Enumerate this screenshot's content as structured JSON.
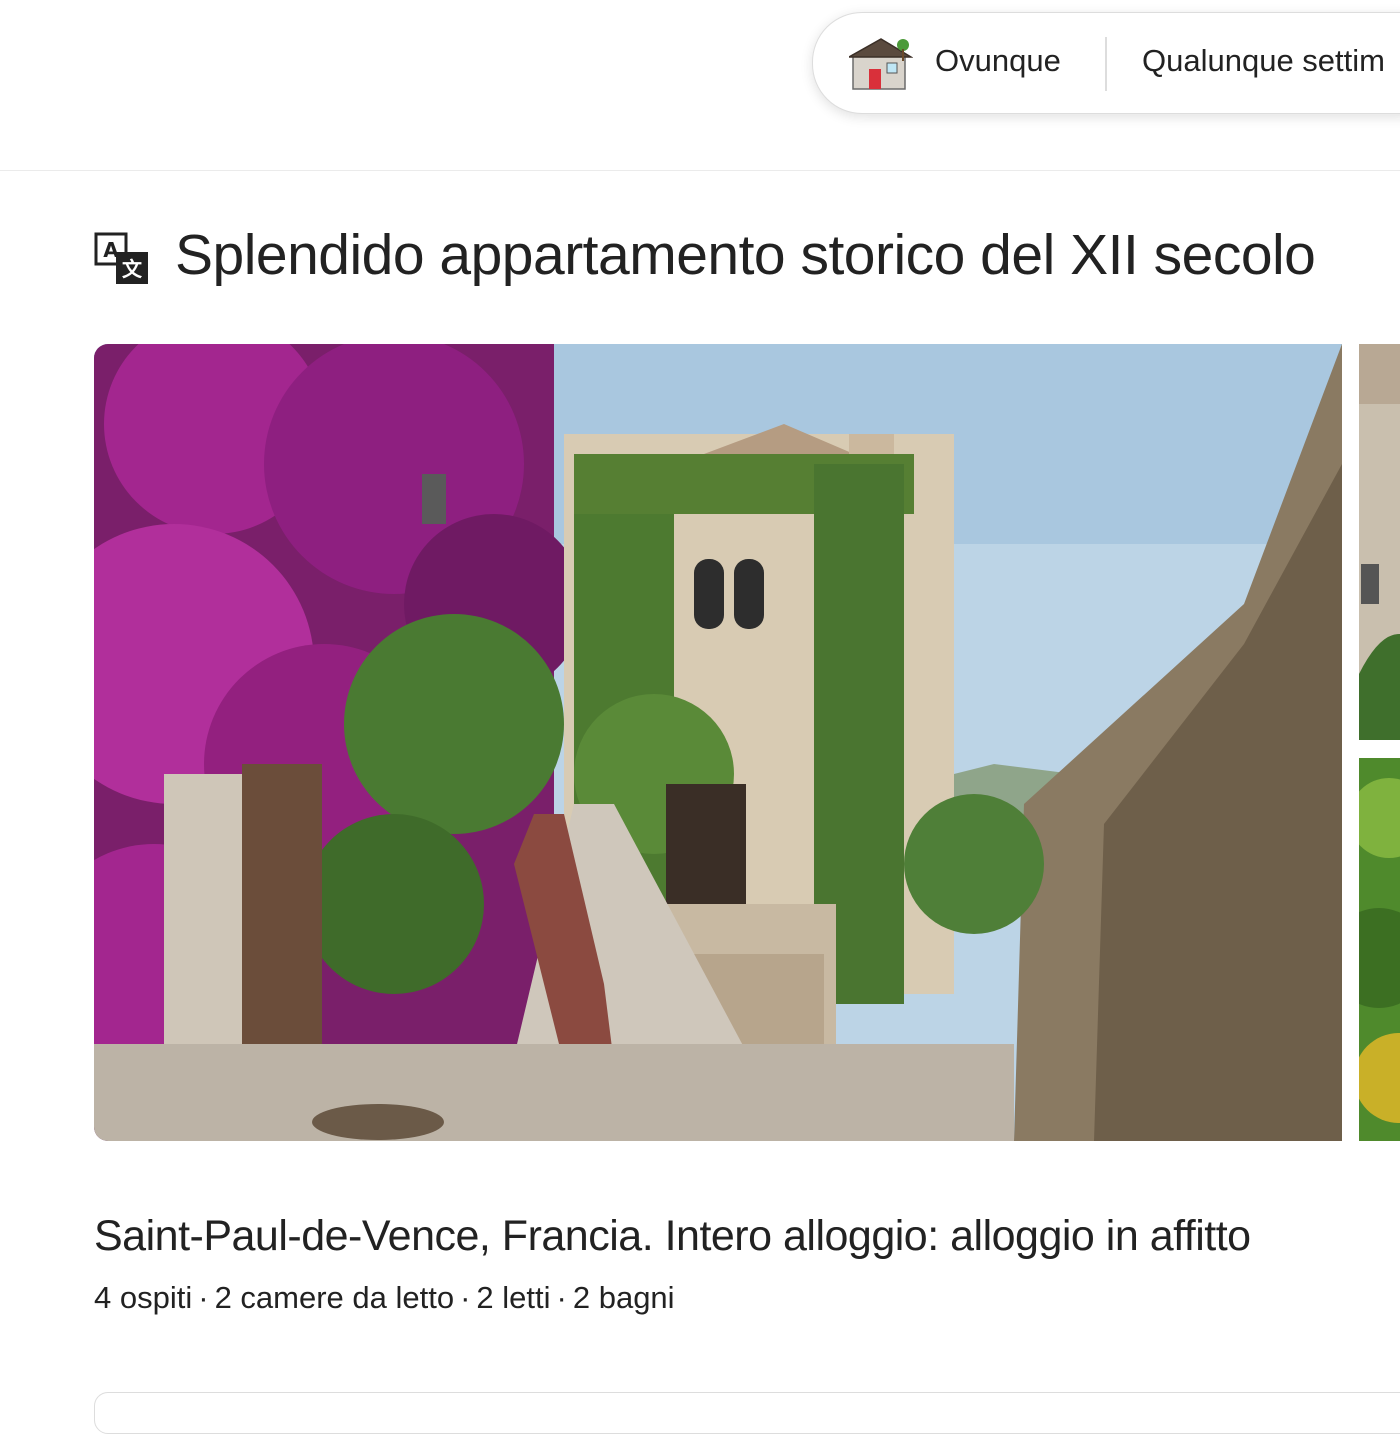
{
  "search": {
    "where_label": "Ovunque",
    "when_label": "Qualunque settim"
  },
  "listing": {
    "title": "Splendido appartamento storico del XII secolo",
    "location_type": "Saint-Paul-de-Vence, Francia. Intero alloggio: alloggio in affitto",
    "details": [
      "4 ospiti",
      "2 camere da letto",
      "2 letti",
      "2 bagni"
    ]
  },
  "icons": {
    "header": "house-icon",
    "title": "translate-icon"
  },
  "colors": {
    "text": "#222222",
    "border": "#dddddd"
  }
}
